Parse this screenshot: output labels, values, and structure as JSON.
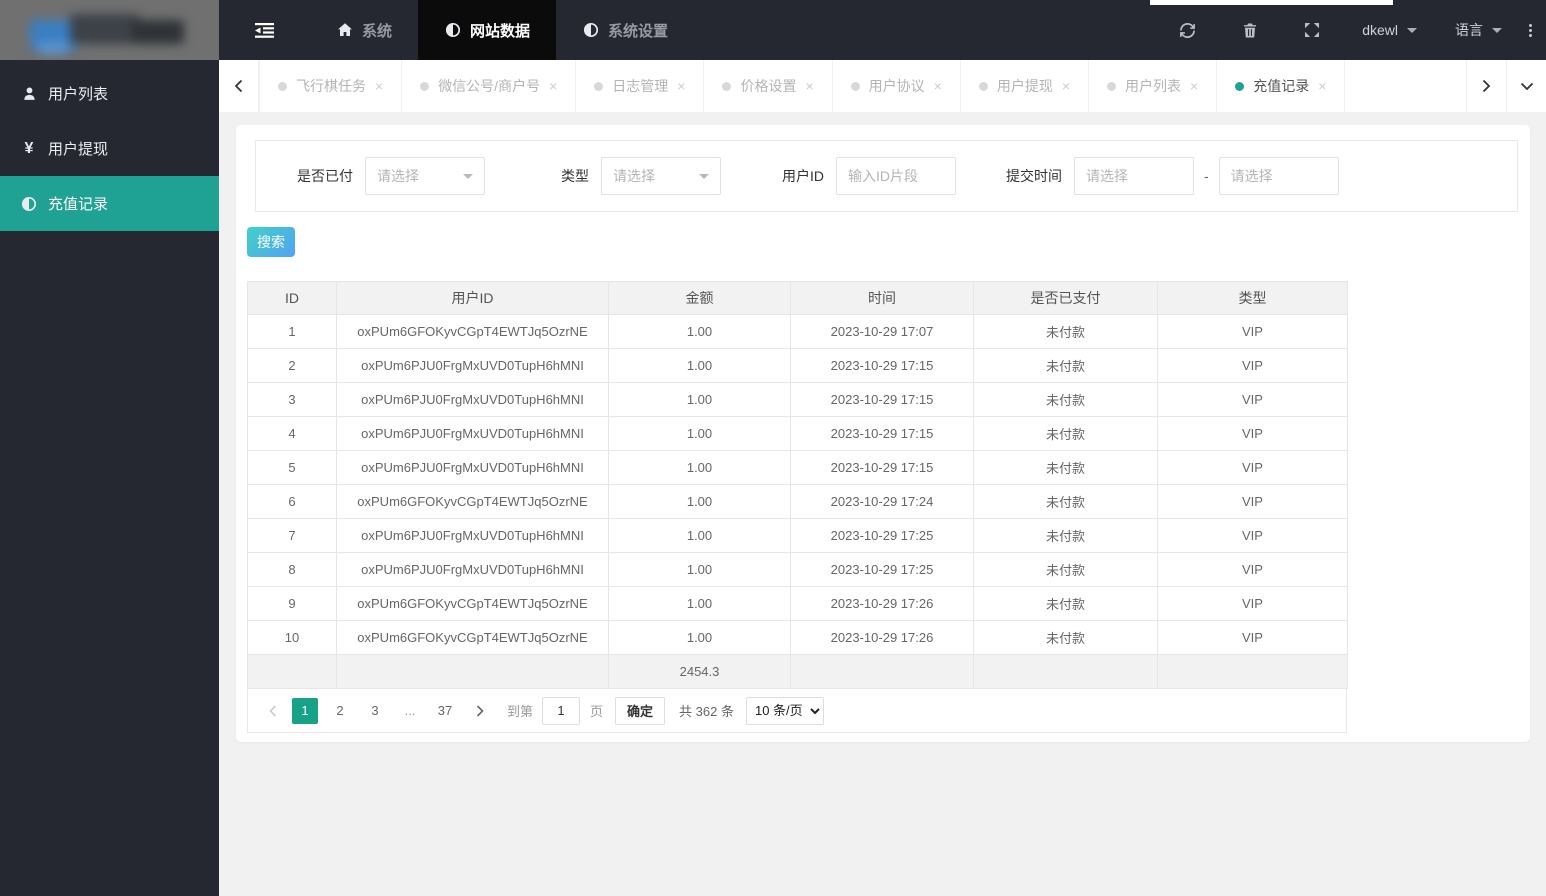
{
  "colors": {
    "accent": "#1fa294",
    "pagination_active": "#17a288",
    "nav_bg": "#252830",
    "nav_active_bg": "#0b0b0b"
  },
  "topnav": {
    "menu": [
      {
        "label": "系统",
        "icon": "home-icon",
        "active": false
      },
      {
        "label": "网站数据",
        "icon": "adjust-icon",
        "active": true
      },
      {
        "label": "系统设置",
        "icon": "adjust-icon",
        "active": false
      }
    ],
    "username": "dkewl",
    "language": "语言"
  },
  "sidebar": {
    "items": [
      {
        "label": "用户列表",
        "icon": "user-icon",
        "active": false
      },
      {
        "label": "用户提现",
        "icon": "yen-icon",
        "active": false
      },
      {
        "label": "充值记录",
        "icon": "adjust-icon",
        "active": true
      }
    ]
  },
  "tabbar": {
    "tabs": [
      {
        "label": "飞行棋任务",
        "active": false
      },
      {
        "label": "微信公号/商户号",
        "active": false
      },
      {
        "label": "日志管理",
        "active": false
      },
      {
        "label": "价格设置",
        "active": false
      },
      {
        "label": "用户协议",
        "active": false
      },
      {
        "label": "用户提现",
        "active": false
      },
      {
        "label": "用户列表",
        "active": false
      },
      {
        "label": "充值记录",
        "active": true
      }
    ],
    "close_glyph": "×"
  },
  "filters": {
    "paid_label": "是否已付",
    "type_label": "类型",
    "user_id_label": "用户ID",
    "submit_time_label": "提交时间",
    "select_placeholder": "请选择",
    "user_id_placeholder": "输入ID片段",
    "range_separator": "-"
  },
  "search_button": "搜索",
  "table": {
    "headers": [
      "ID",
      "用户ID",
      "金额",
      "时间",
      "是否已支付",
      "类型"
    ],
    "rows": [
      [
        "1",
        "oxPUm6GFOKyvCGpT4EWTJq5OzrNE",
        "1.00",
        "2023-10-29 17:07",
        "未付款",
        "VIP"
      ],
      [
        "2",
        "oxPUm6PJU0FrgMxUVD0TupH6hMNI",
        "1.00",
        "2023-10-29 17:15",
        "未付款",
        "VIP"
      ],
      [
        "3",
        "oxPUm6PJU0FrgMxUVD0TupH6hMNI",
        "1.00",
        "2023-10-29 17:15",
        "未付款",
        "VIP"
      ],
      [
        "4",
        "oxPUm6PJU0FrgMxUVD0TupH6hMNI",
        "1.00",
        "2023-10-29 17:15",
        "未付款",
        "VIP"
      ],
      [
        "5",
        "oxPUm6PJU0FrgMxUVD0TupH6hMNI",
        "1.00",
        "2023-10-29 17:15",
        "未付款",
        "VIP"
      ],
      [
        "6",
        "oxPUm6GFOKyvCGpT4EWTJq5OzrNE",
        "1.00",
        "2023-10-29 17:24",
        "未付款",
        "VIP"
      ],
      [
        "7",
        "oxPUm6PJU0FrgMxUVD0TupH6hMNI",
        "1.00",
        "2023-10-29 17:25",
        "未付款",
        "VIP"
      ],
      [
        "8",
        "oxPUm6PJU0FrgMxUVD0TupH6hMNI",
        "1.00",
        "2023-10-29 17:25",
        "未付款",
        "VIP"
      ],
      [
        "9",
        "oxPUm6GFOKyvCGpT4EWTJq5OzrNE",
        "1.00",
        "2023-10-29 17:26",
        "未付款",
        "VIP"
      ],
      [
        "10",
        "oxPUm6GFOKyvCGpT4EWTJq5OzrNE",
        "1.00",
        "2023-10-29 17:26",
        "未付款",
        "VIP"
      ]
    ],
    "total_amount": "2454.3"
  },
  "pagination": {
    "pages": [
      "1",
      "2",
      "3",
      "...",
      "37"
    ],
    "current": "1",
    "goto_label": "到第",
    "goto_value": "1",
    "page_unit": "页",
    "confirm_label": "确定",
    "total_label": "共 362 条",
    "page_size_option": "10 条/页"
  }
}
